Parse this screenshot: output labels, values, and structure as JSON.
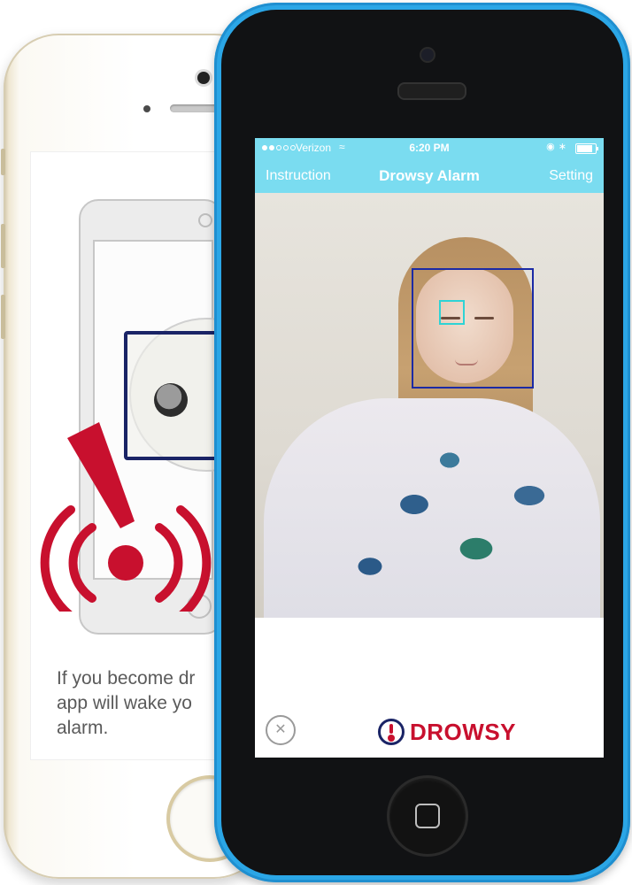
{
  "back_screen": {
    "caption_lines": [
      "If you become dr",
      "app will wake yo",
      "alarm."
    ]
  },
  "status_bar": {
    "carrier": "Verizon",
    "time": "6:20 PM"
  },
  "nav": {
    "left": "Instruction",
    "title": "Drowsy Alarm",
    "right": "Setting"
  },
  "logo": {
    "text": "DROWSY"
  },
  "icons": {
    "camera_toggle": "camera-off-icon",
    "alert": "alarm-alert-icon"
  },
  "colors": {
    "phone_body": "#2ba6e6",
    "nav_bar": "#7adcf0",
    "brand_red": "#c8102e",
    "brand_navy": "#1a2466",
    "face_box": "#1b2aa5",
    "eye_box": "#2fd3d5"
  }
}
